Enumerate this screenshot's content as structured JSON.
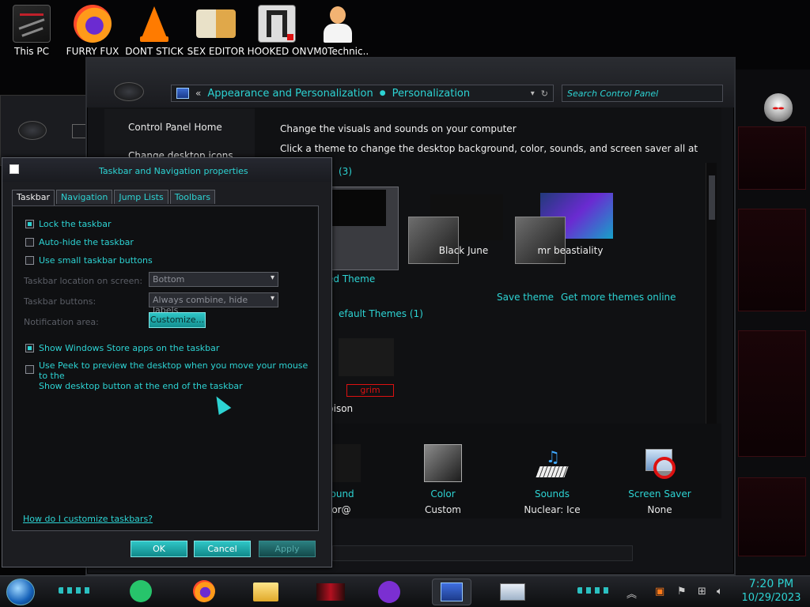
{
  "desktop_icons": [
    {
      "label": "This PC",
      "icon": "this-pc-icon"
    },
    {
      "label": "FURRY FUX",
      "icon": "firefox-icon"
    },
    {
      "label": "DONT STICK",
      "icon": "vlc-icon"
    },
    {
      "label": "SEX EDITOR",
      "icon": "xd-editor-icon"
    },
    {
      "label": "HOOKED ON",
      "icon": "app-shortcut-icon"
    },
    {
      "label": "VM0Technic...",
      "icon": "doctor-avatar-icon"
    }
  ],
  "control_panel": {
    "address": {
      "back_glyph": "«",
      "crumb1": "Appearance and Personalization",
      "crumb2": "Personalization"
    },
    "search_placeholder": "Search Control Panel",
    "left_links": [
      "Control Panel Home",
      "Change desktop icons"
    ],
    "hint_line1": "Change the visuals and sounds on your computer",
    "hint_line2": "Click a theme to change the desktop background, color, sounds, and screen saver all at once.",
    "my_themes_count": "(3)",
    "themes": [
      {
        "name": "ed Theme"
      },
      {
        "name": "Black June"
      },
      {
        "name": "mr beastiality"
      }
    ],
    "save_theme": "Save theme",
    "get_more": "Get more themes online",
    "default_group": "efault Themes (1)",
    "default_theme_name": "bison",
    "bottom": [
      {
        "title": "ackground",
        "value": "cryptor@"
      },
      {
        "title": "Color",
        "value": "Custom"
      },
      {
        "title": "Sounds",
        "value": "Nuclear: Ice"
      },
      {
        "title": "Screen Saver",
        "value": "None"
      }
    ]
  },
  "dialog": {
    "title": "Taskbar and Navigation properties",
    "tabs": [
      "Taskbar",
      "Navigation",
      "Jump Lists",
      "Toolbars"
    ],
    "options": {
      "lock": "Lock the taskbar",
      "autohide": "Auto-hide the taskbar",
      "small_buttons": "Use small taskbar buttons",
      "store_apps": "Show Windows Store apps on the taskbar",
      "peek_line1": "Use Peek to preview the desktop when you move your mouse to the",
      "peek_line2": "Show desktop button at the end of the taskbar"
    },
    "labels": {
      "location": "Taskbar location on screen:",
      "buttons": "Taskbar buttons:",
      "notification": "Notification area:"
    },
    "location_value": "Bottom",
    "buttons_value": "Always combine, hide labels",
    "customize": "Customize...",
    "help": "How do I customize taskbars?",
    "ok": "OK",
    "cancel": "Cancel",
    "apply": "Apply"
  },
  "taskbar": {
    "time": "7:20 PM",
    "date": "10/29/2023"
  },
  "colors": {
    "accent": "#2dd3d3",
    "alien_red": "#e3182d"
  }
}
